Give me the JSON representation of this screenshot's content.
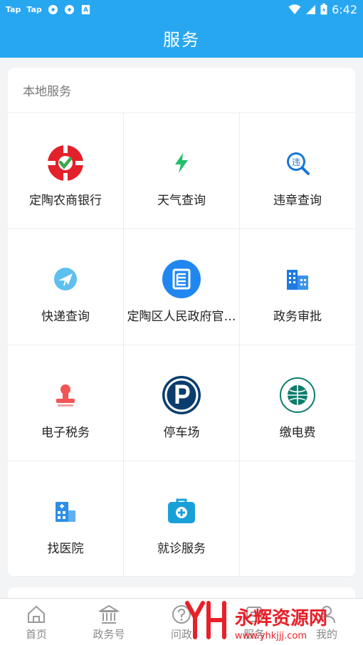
{
  "status_bar": {
    "left_items": [
      "Tap",
      "Tap"
    ],
    "time": "6:42"
  },
  "header": {
    "title": "服务"
  },
  "local_services": {
    "title": "本地服务",
    "items": [
      {
        "label": "定陶农商银行",
        "icon": "bank-logo-icon"
      },
      {
        "label": "天气查询",
        "icon": "lightning-icon"
      },
      {
        "label": "违章查询",
        "icon": "violation-search-icon"
      },
      {
        "label": "快递查询",
        "icon": "express-plane-icon"
      },
      {
        "label": "定陶区人民政府官…",
        "icon": "government-site-icon"
      },
      {
        "label": "政务审批",
        "icon": "building-icon"
      },
      {
        "label": "电子税务",
        "icon": "stamp-icon"
      },
      {
        "label": "停车场",
        "icon": "parking-icon"
      },
      {
        "label": "缴电费",
        "icon": "state-grid-logo-icon"
      },
      {
        "label": "找医院",
        "icon": "hospital-icon"
      },
      {
        "label": "就诊服务",
        "icon": "medical-kit-icon"
      }
    ]
  },
  "tabbar": {
    "items": [
      {
        "label": "首页",
        "icon": "home-icon"
      },
      {
        "label": "政务号",
        "icon": "government-building-icon"
      },
      {
        "label": "问政",
        "icon": "question-icon"
      },
      {
        "label": "服务",
        "icon": "service-icon"
      },
      {
        "label": "我的",
        "icon": "profile-icon"
      }
    ]
  },
  "watermark": {
    "logo": "YH",
    "name": "永辉资源网",
    "url": "www.yhkjjj.com"
  },
  "colors": {
    "header": "#28a7f1",
    "watermark": "#e8202a"
  }
}
